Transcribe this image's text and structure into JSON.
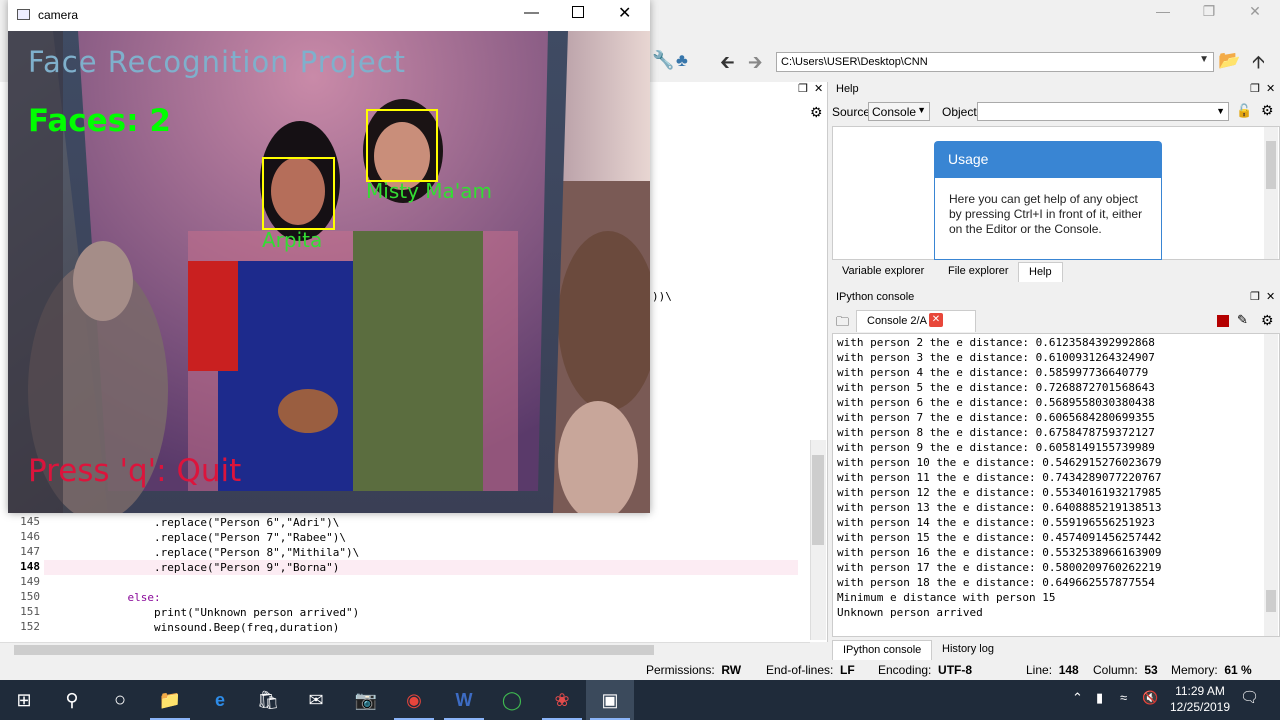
{
  "camera": {
    "title": "camera",
    "overlay_title": "Face Recognition Project",
    "faces_label": "Faces: 2",
    "quit_label": "Press 'q': Quit",
    "faces": [
      {
        "name": "Arpita"
      },
      {
        "name": "Misty Ma'am"
      }
    ]
  },
  "path": "C:\\Users\\USER\\Desktop\\CNN",
  "editor": {
    "fragment": "))\\",
    "lines": [
      {
        "num": "145",
        "code": "                .replace(\"Person 6\",\"Adri\")\\"
      },
      {
        "num": "146",
        "code": "                .replace(\"Person 7\",\"Rabee\")\\"
      },
      {
        "num": "147",
        "code": "                .replace(\"Person 8\",\"Mithila\")\\"
      },
      {
        "num": "148",
        "code": "                .replace(\"Person 9\",\"Borna\")"
      },
      {
        "num": "149",
        "code": ""
      },
      {
        "num": "150",
        "code": "            else:"
      },
      {
        "num": "151",
        "code": "                print(\"Unknown person arrived\")"
      },
      {
        "num": "152",
        "code": "                winsound.Beep(freq,duration)"
      }
    ]
  },
  "help": {
    "title": "Help",
    "source_label": "Source",
    "source_value": "Console",
    "object_label": "Object",
    "usage_title": "Usage",
    "usage_text": "Here you can get help of any object by pressing Ctrl+I in front of it, either on the Editor or the Console.",
    "tabs": [
      "Variable explorer",
      "File explorer",
      "Help"
    ]
  },
  "ipython": {
    "title": "IPython console",
    "tab": "Console 2/A",
    "lines": [
      "with person 2 the e distance: 0.6123584392992868",
      "with person 3 the e distance: 0.6100931264324907",
      "with person 4 the e distance: 0.585997736640779",
      "with person 5 the e distance: 0.7268872701568643",
      "with person 6 the e distance: 0.5689558030380438",
      "with person 7 the e distance: 0.6065684280699355",
      "with person 8 the e distance: 0.6758478759372127",
      "with person 9 the e distance: 0.6058149155739989",
      "with person 10 the e distance: 0.5462915276023679",
      "with person 11 the e distance: 0.7434289077220767",
      "with person 12 the e distance: 0.5534016193217985",
      "with person 13 the e distance: 0.6408885219138513",
      "with person 14 the e distance: 0.559196556251923",
      "with person 15 the e distance: 0.4574091456257442",
      "with person 16 the e distance: 0.5532538966163909",
      "with person 17 the e distance: 0.5800209760262219",
      "with person 18 the e distance: 0.649662557877554",
      "Minimum e distance with person 15",
      "Unknown person arrived"
    ],
    "bottom_tabs": [
      "IPython console",
      "History log"
    ]
  },
  "status": {
    "permissions_label": "Permissions:",
    "permissions": "RW",
    "eol_label": "End-of-lines:",
    "eol": "LF",
    "encoding_label": "Encoding:",
    "encoding": "UTF-8",
    "line_label": "Line:",
    "line": "148",
    "column_label": "Column:",
    "column": "53",
    "memory_label": "Memory:",
    "memory": "61 %"
  },
  "clock": {
    "time": "11:29 AM",
    "date": "12/25/2019"
  },
  "colors": {
    "overlay_title": "#7fb0cc",
    "faces": "#00ff00",
    "quit": "#dc143c",
    "face_box": "#ffff00",
    "name": "#33dd33"
  }
}
